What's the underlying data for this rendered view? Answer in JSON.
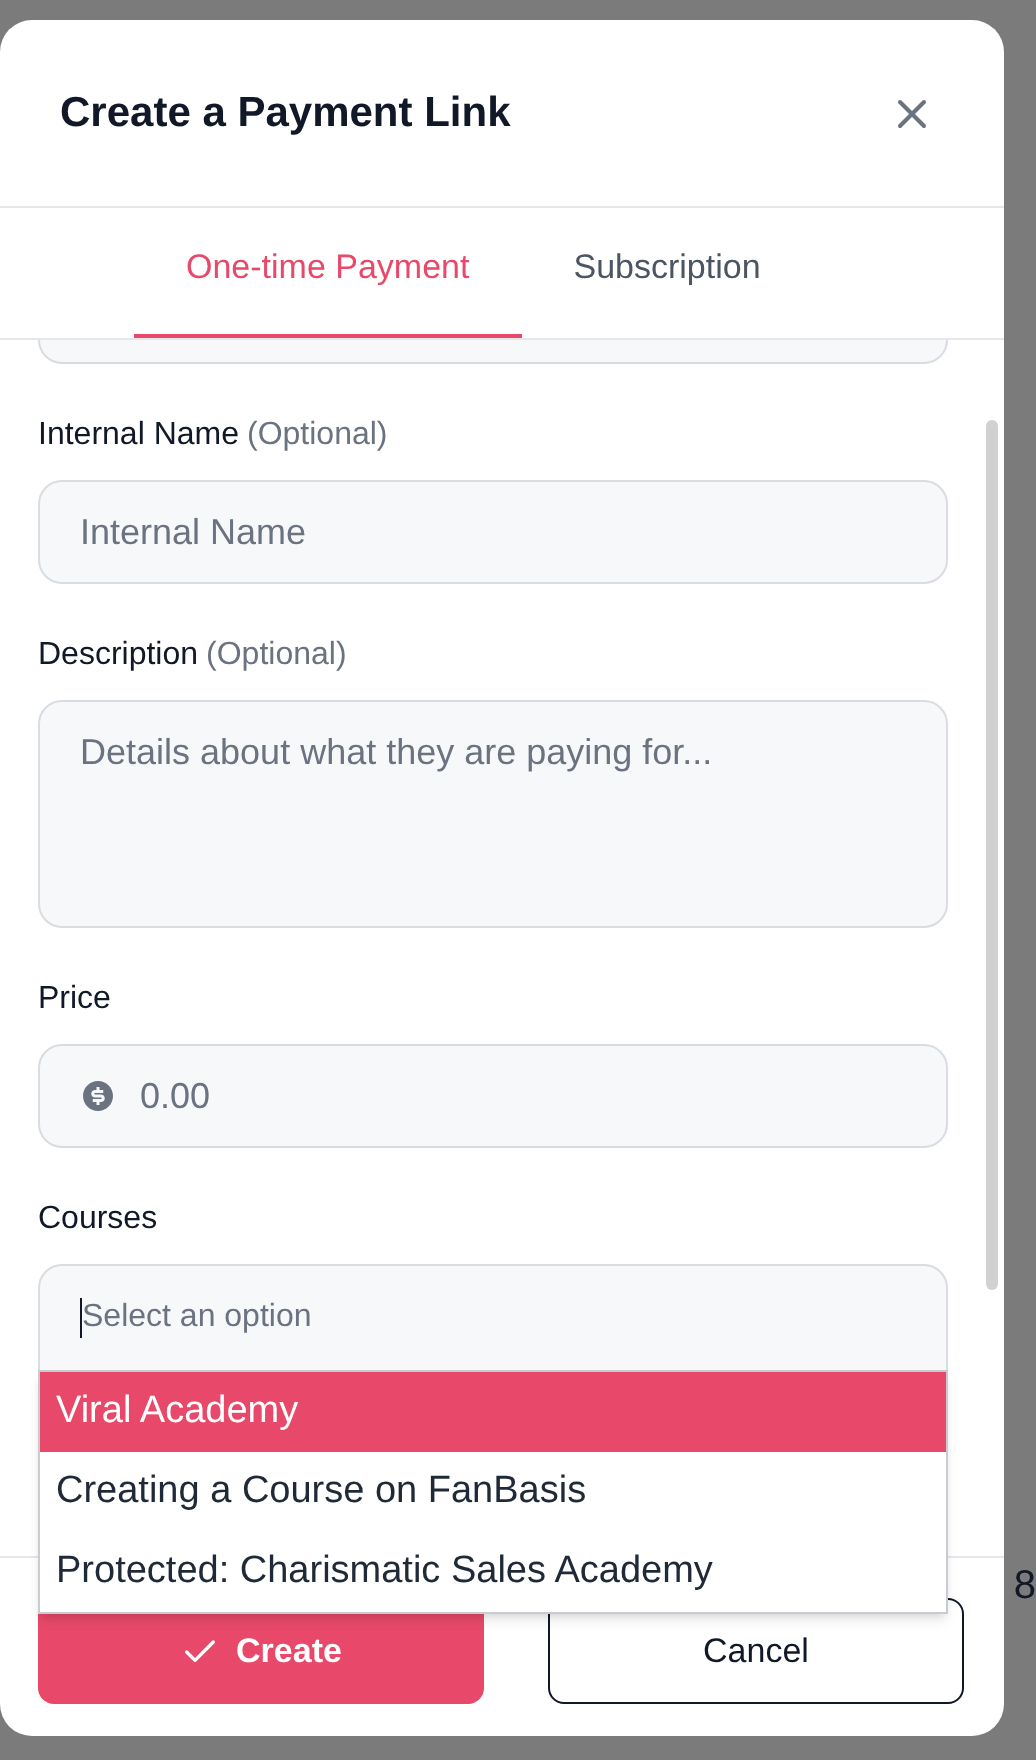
{
  "dialog": {
    "title": "Create a Payment Link"
  },
  "tabs": [
    {
      "label": "One-time Payment",
      "selected": true
    },
    {
      "label": "Subscription",
      "selected": false
    }
  ],
  "fields": [
    {
      "kind": "input",
      "label": "Internal Name",
      "hint": "(Optional)",
      "placeholder": "Internal Name"
    },
    {
      "kind": "textarea",
      "label": "Description",
      "hint": "(Optional)",
      "placeholder": "Details about what they are paying for..."
    },
    {
      "kind": "price",
      "label": "Price",
      "placeholder": "0.00"
    },
    {
      "kind": "select",
      "label": "Courses",
      "placeholder": "Select an option",
      "options": [
        {
          "label": "Viral Academy",
          "selected": true
        },
        {
          "label": "Creating a Course on FanBasis",
          "selected": false
        },
        {
          "label": "Protected: Charismatic Sales Academy",
          "selected": false
        }
      ]
    }
  ],
  "buttons": [
    {
      "kind": "primary",
      "label": "Create"
    },
    {
      "kind": "secondary",
      "label": "Cancel"
    }
  ],
  "background_text": "8"
}
